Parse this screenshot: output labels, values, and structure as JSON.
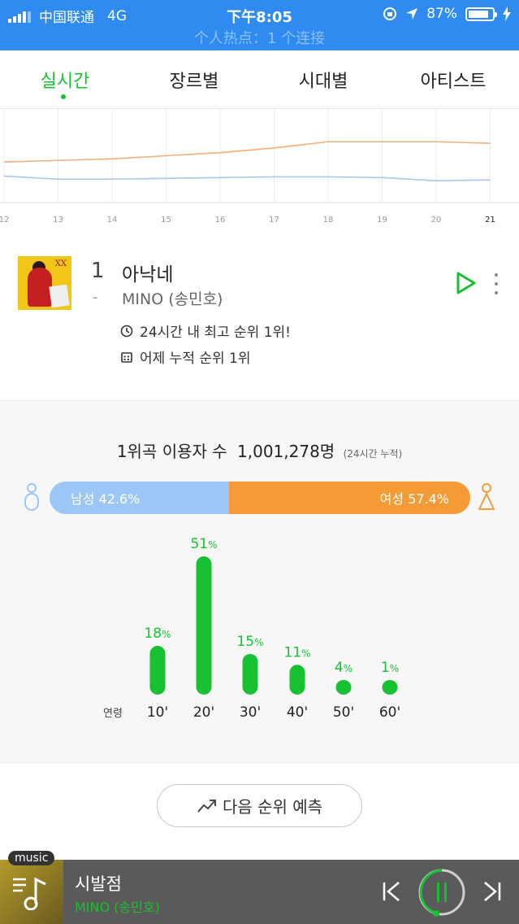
{
  "status_bar": {
    "carrier": "中国联通",
    "network": "4G",
    "time": "下午8:05",
    "battery": "87%",
    "hotspot": "个人热点：1 个连接"
  },
  "tabs": [
    {
      "label": "실시간",
      "active": true
    },
    {
      "label": "장르별",
      "active": false
    },
    {
      "label": "시대별",
      "active": false
    },
    {
      "label": "아티스트",
      "active": false
    }
  ],
  "chart_data": [
    {
      "type": "line",
      "x": [
        "12",
        "13",
        "14",
        "15",
        "16",
        "17",
        "18",
        "19",
        "20",
        "21"
      ],
      "series": [
        {
          "values": [
            3.4,
            3.3,
            3.2,
            3.0,
            2.8,
            2.5,
            2.1,
            2.1,
            2.1,
            2.2
          ]
        },
        {
          "values": [
            4.3,
            4.5,
            4.5,
            4.45,
            4.4,
            4.35,
            4.35,
            4.4,
            4.6,
            4.55
          ]
        }
      ],
      "colors": [
        "#f5ae77",
        "#a9c6f0"
      ],
      "highlight_tick": "21"
    },
    {
      "type": "bar",
      "xlabel": "연령",
      "categories": [
        "10'",
        "20'",
        "30'",
        "40'",
        "50'",
        "60'"
      ],
      "values": [
        18,
        51,
        15,
        11,
        4,
        1
      ],
      "unit": "%",
      "color": "#18c132"
    }
  ],
  "song": {
    "rank": "1",
    "rank_change": "-",
    "title": "아낙네",
    "artist": "MINO (송민호)",
    "info_peak": "24시간 내 최고 순위 1위!",
    "info_cumulative": "어제 누적 순위 1위"
  },
  "stats": {
    "users_label": "1위곡 이용자 수",
    "users_count": "1,001,278명",
    "users_note": "(24시간 누적)",
    "male_label": "남성 42.6%",
    "female_label": "여성 57.4%",
    "male_ratio": 42.6,
    "female_ratio": 57.4,
    "male_color": "#9cc6f5",
    "female_color": "#f59b36"
  },
  "predict_button": "다음 순위 예측",
  "player": {
    "tag": "music",
    "title": "시발점",
    "artist": "MINO (송민호)",
    "accent": "#18c132"
  }
}
